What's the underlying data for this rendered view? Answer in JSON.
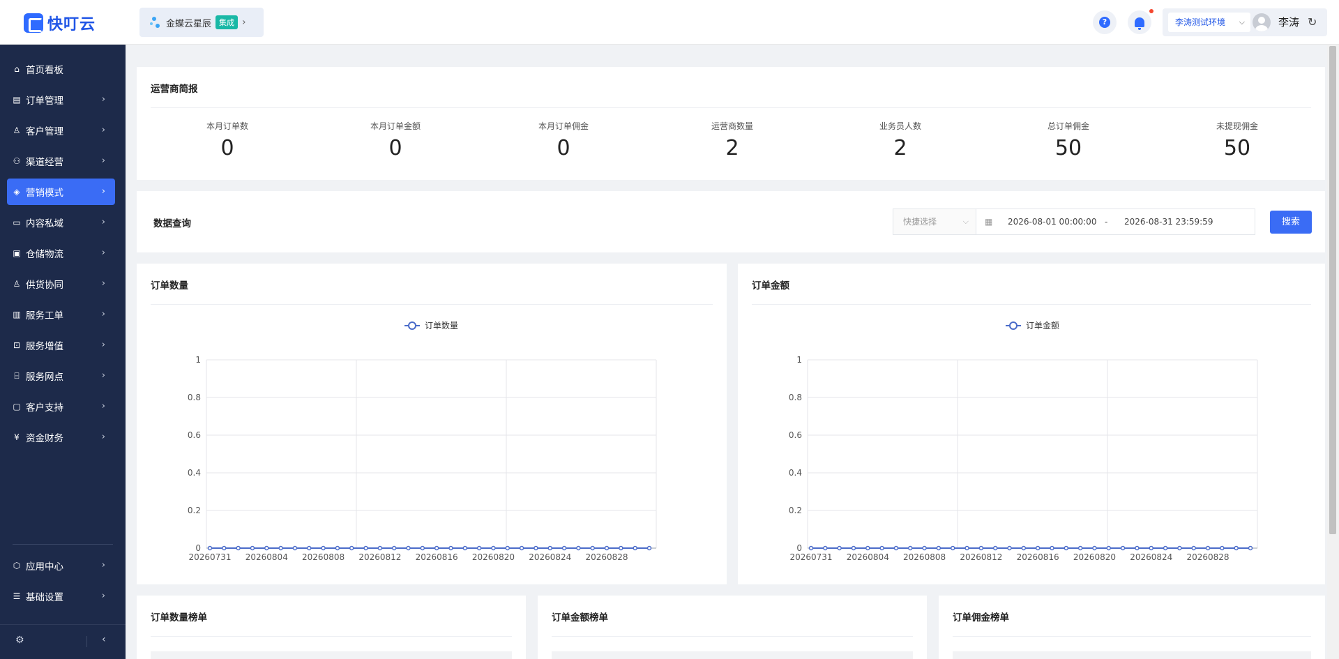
{
  "header": {
    "logo_text": "快叮云",
    "integration": {
      "name": "金蝶云星辰",
      "tag": "集成"
    },
    "environment": "李涛测试环境",
    "user_name": "李涛"
  },
  "sidebar": {
    "items": [
      {
        "label": "首页看板",
        "icon": "home-icon",
        "has_children": false,
        "active": false
      },
      {
        "label": "订单管理",
        "icon": "document-icon",
        "has_children": true,
        "active": false
      },
      {
        "label": "客户管理",
        "icon": "user-icon",
        "has_children": true,
        "active": false
      },
      {
        "label": "渠道经营",
        "icon": "channel-icon",
        "has_children": true,
        "active": false
      },
      {
        "label": "营销模式",
        "icon": "tag-icon",
        "has_children": true,
        "active": true
      },
      {
        "label": "内容私域",
        "icon": "image-icon",
        "has_children": true,
        "active": false
      },
      {
        "label": "仓储物流",
        "icon": "box-icon",
        "has_children": true,
        "active": false
      },
      {
        "label": "供货协同",
        "icon": "supply-icon",
        "has_children": true,
        "active": false
      },
      {
        "label": "服务工单",
        "icon": "ticket-icon",
        "has_children": true,
        "active": false
      },
      {
        "label": "服务增值",
        "icon": "bag-icon",
        "has_children": true,
        "active": false
      },
      {
        "label": "服务网点",
        "icon": "store-icon",
        "has_children": true,
        "active": false
      },
      {
        "label": "客户支持",
        "icon": "support-icon",
        "has_children": true,
        "active": false
      },
      {
        "label": "资金财务",
        "icon": "yen-icon",
        "has_children": true,
        "active": false
      }
    ],
    "bottom_items": [
      {
        "label": "应用中心",
        "icon": "cube-icon"
      },
      {
        "label": "基础设置",
        "icon": "settings-list-icon"
      }
    ]
  },
  "summary": {
    "title": "运营商简报",
    "stats": [
      {
        "label": "本月订单数",
        "value": "0"
      },
      {
        "label": "本月订单金额",
        "value": "0"
      },
      {
        "label": "本月订单佣金",
        "value": "0"
      },
      {
        "label": "运营商数量",
        "value": "2"
      },
      {
        "label": "业务员人数",
        "value": "2"
      },
      {
        "label": "总订单佣金",
        "value": "50"
      },
      {
        "label": "未提现佣金",
        "value": "50"
      }
    ]
  },
  "query": {
    "title": "数据查询",
    "quick_select_placeholder": "快捷选择",
    "start": "2026-08-01 00:00:00",
    "separator": "-",
    "end": "2026-08-31 23:59:59",
    "search_label": "搜索"
  },
  "charts": {
    "count_title": "订单数量",
    "amount_title": "订单金额"
  },
  "chart_data": [
    {
      "type": "line",
      "title": "订单数量",
      "series": [
        {
          "name": "订单数量",
          "values": [
            0,
            0,
            0,
            0,
            0,
            0,
            0,
            0,
            0,
            0,
            0,
            0,
            0,
            0,
            0,
            0,
            0,
            0,
            0,
            0,
            0,
            0,
            0,
            0,
            0,
            0,
            0,
            0,
            0,
            0,
            0,
            0
          ]
        }
      ],
      "x": [
        "20260731",
        "20260801",
        "20260802",
        "20260803",
        "20260804",
        "20260805",
        "20260806",
        "20260807",
        "20260808",
        "20260809",
        "20260810",
        "20260811",
        "20260812",
        "20260813",
        "20260814",
        "20260815",
        "20260816",
        "20260817",
        "20260818",
        "20260819",
        "20260820",
        "20260821",
        "20260822",
        "20260823",
        "20260824",
        "20260825",
        "20260826",
        "20260827",
        "20260828",
        "20260829",
        "20260830",
        "20260831"
      ],
      "x_tick_labels": [
        "20260731",
        "20260804",
        "20260808",
        "20260812",
        "20260816",
        "20260820",
        "20260824",
        "20260828"
      ],
      "y_ticks": [
        "0",
        "0.2",
        "0.4",
        "0.6",
        "0.8",
        "1"
      ],
      "ylim": [
        0,
        1
      ],
      "color": "#4a6bc9",
      "legend": "top"
    },
    {
      "type": "line",
      "title": "订单金额",
      "series": [
        {
          "name": "订单金额",
          "values": [
            0,
            0,
            0,
            0,
            0,
            0,
            0,
            0,
            0,
            0,
            0,
            0,
            0,
            0,
            0,
            0,
            0,
            0,
            0,
            0,
            0,
            0,
            0,
            0,
            0,
            0,
            0,
            0,
            0,
            0,
            0,
            0
          ]
        }
      ],
      "x": [
        "20260731",
        "20260801",
        "20260802",
        "20260803",
        "20260804",
        "20260805",
        "20260806",
        "20260807",
        "20260808",
        "20260809",
        "20260810",
        "20260811",
        "20260812",
        "20260813",
        "20260814",
        "20260815",
        "20260816",
        "20260817",
        "20260818",
        "20260819",
        "20260820",
        "20260821",
        "20260822",
        "20260823",
        "20260824",
        "20260825",
        "20260826",
        "20260827",
        "20260828",
        "20260829",
        "20260830",
        "20260831"
      ],
      "x_tick_labels": [
        "20260731",
        "20260804",
        "20260808",
        "20260812",
        "20260816",
        "20260820",
        "20260824",
        "20260828"
      ],
      "y_ticks": [
        "0",
        "0.2",
        "0.4",
        "0.6",
        "0.8",
        "1"
      ],
      "ylim": [
        0,
        1
      ],
      "color": "#4a6bc9",
      "legend": "top"
    }
  ],
  "rankings": {
    "count_title": "订单数量榜单",
    "amount_title": "订单金额榜单",
    "commission_title": "订单佣金榜单"
  },
  "colors": {
    "accent": "#3a6cf5",
    "sidebar": "#1d2a4a",
    "series": "#4a6bc9"
  }
}
